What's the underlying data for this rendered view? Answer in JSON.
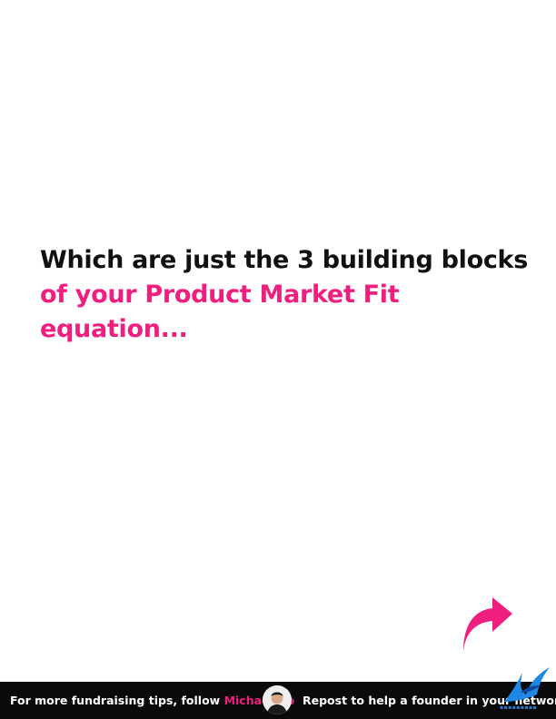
{
  "headline": {
    "line1": "Which are just the 3 building blocks",
    "line2": "of your Product Market Fit equation..."
  },
  "next_arrow": {
    "icon": "curved-arrow-right-icon",
    "color": "#ee1f7f"
  },
  "footer": {
    "follow_text": "For more fundraising tips, follow",
    "author_name": "Michael Ho",
    "repost_text": "Repost to help a founder in your network"
  },
  "colors": {
    "accent": "#ee1f7f",
    "text": "#111111",
    "footer_bg": "#0a0a0a"
  }
}
